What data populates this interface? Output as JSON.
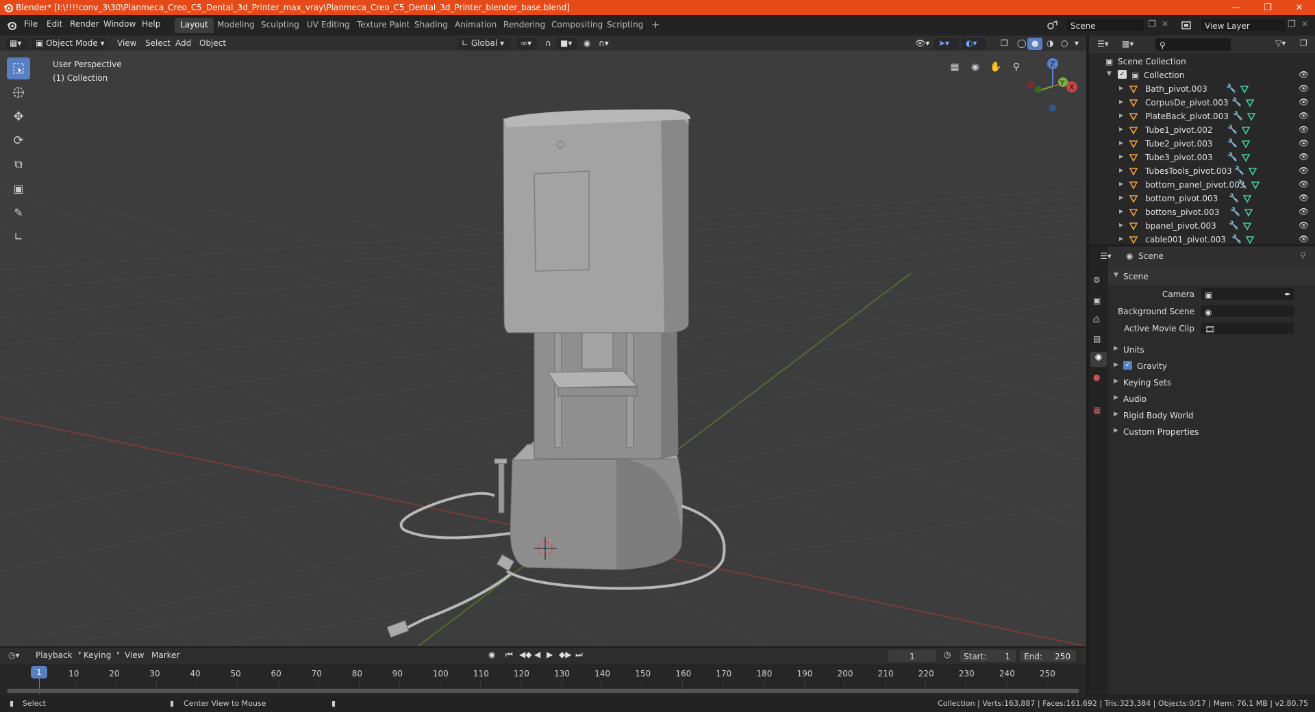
{
  "window": {
    "title": "Blender* [I:\\!!!!conv_3\\30\\Planmeca_Creo_C5_Dental_3d_Printer_max_vray\\Planmeca_Creo_C5_Dental_3d_Printer_blender_base.blend]",
    "accent": "#e64a19"
  },
  "menu": [
    "File",
    "Edit",
    "Render",
    "Window",
    "Help"
  ],
  "workspaces": [
    "Layout",
    "Modeling",
    "Sculpting",
    "UV Editing",
    "Texture Paint",
    "Shading",
    "Animation",
    "Rendering",
    "Compositing",
    "Scripting"
  ],
  "active_workspace": "Layout",
  "scene_field": "Scene",
  "view_layer_field": "View Layer",
  "viewport_header": {
    "mode": "Object Mode",
    "menus": [
      "View",
      "Select",
      "Add",
      "Object"
    ],
    "orientation": "Global"
  },
  "viewport": {
    "perspective_label": "User Perspective",
    "collection_label": "(1) Collection",
    "gizmo_axes": {
      "z": "Z",
      "y": "Y",
      "x": "X"
    }
  },
  "outliner": {
    "root": "Scene Collection",
    "collection": "Collection",
    "items": [
      "Bath_pivot.003",
      "CorpusDe_pivot.003",
      "PlateBack_pivot.003",
      "Tube1_pivot.002",
      "Tube2_pivot.003",
      "Tube3_pivot.003",
      "TubesTools_pivot.003",
      "bottom_panel_pivot.003",
      "bottom_pivot.003",
      "bottons_pivot.003",
      "bpanel_pivot.003",
      "cable001_pivot.003"
    ]
  },
  "properties": {
    "context": "Scene",
    "panel": "Scene",
    "fields": [
      {
        "label": "Camera",
        "value": ""
      },
      {
        "label": "Background Scene",
        "value": ""
      },
      {
        "label": "Active Movie Clip",
        "value": ""
      }
    ],
    "sections": [
      "Units",
      "Gravity",
      "Keying Sets",
      "Audio",
      "Rigid Body World",
      "Custom Properties"
    ],
    "gravity_checked": true
  },
  "timeline": {
    "menus": [
      "Playback",
      "Keying",
      "View",
      "Marker"
    ],
    "current_frame": "1",
    "start_label": "Start:",
    "start": "1",
    "end_label": "End:",
    "end": "250",
    "ticks": [
      "1",
      "10",
      "20",
      "30",
      "40",
      "50",
      "60",
      "70",
      "80",
      "90",
      "100",
      "110",
      "120",
      "130",
      "140",
      "150",
      "160",
      "170",
      "180",
      "190",
      "200",
      "210",
      "220",
      "230",
      "240",
      "250"
    ]
  },
  "status": {
    "select": "Select",
    "center_view": "Center View to Mouse",
    "stats": "Collection | Verts:163,887 | Faces:161,692 | Tris:323,384 | Objects:0/17 | Mem: 76.1 MB | v2.80.75"
  }
}
